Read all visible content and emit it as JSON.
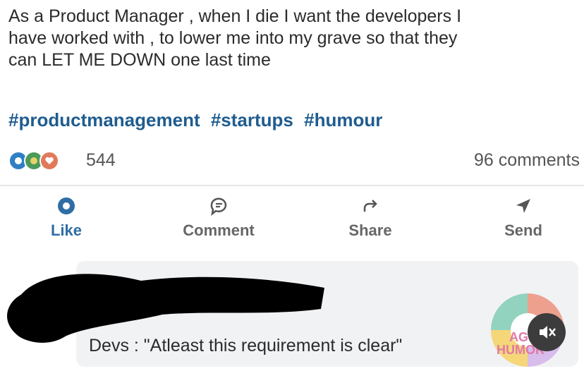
{
  "post": {
    "lines": [
      "As a Product Manager , when I die I want the developers I",
      "have worked with , to lower me into my grave so that they",
      "can LET ME DOWN one last time"
    ],
    "hashtags": [
      "#productmanagement",
      "#startups",
      "#humour"
    ]
  },
  "social_counts": {
    "reactions": "544",
    "comments": "96 comments"
  },
  "actions": {
    "like": "Like",
    "comment": "Comment",
    "share": "Share",
    "send": "Send"
  },
  "comment": {
    "text": "Devs : \"Atleast this requirement is clear\""
  },
  "watermark": {
    "line1": "AG",
    "line2": "HUMOR"
  },
  "colors": {
    "hashtag": "#1f5c8f",
    "like_accent": "#2f6ea5",
    "comment_bg": "#f1f2f4"
  },
  "icons": [
    "like-icon",
    "comment-icon",
    "share-icon",
    "send-icon",
    "mute-icon"
  ]
}
